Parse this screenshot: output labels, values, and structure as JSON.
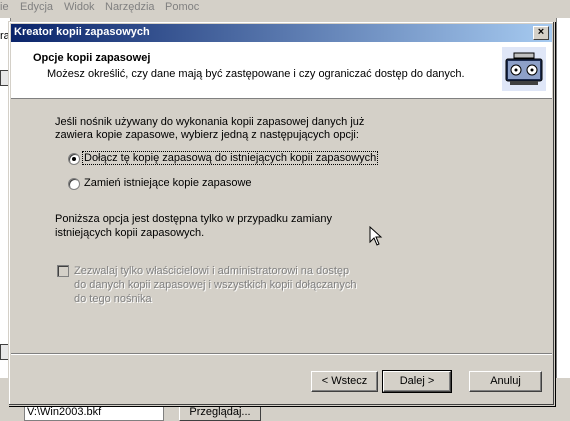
{
  "background_app": {
    "menu": [
      "ie",
      "Edycja",
      "Widok",
      "Narzędzia",
      "Pomoc"
    ],
    "cut_text": "ra",
    "backup_path": "V:\\Win2003.bkf",
    "browse_label": "Przeglądaj..."
  },
  "dialog": {
    "title": "Kreator kopii zapasowych",
    "close_glyph": "×",
    "header": {
      "title": "Opcje kopii zapasowej",
      "subtitle": "Możesz określić, czy dane mają być zastępowane i czy ograniczać dostęp do danych."
    },
    "intro_line1": "Jeśli nośnik używany do wykonania kopii zapasowej danych już",
    "intro_line2": "zawiera kopie zapasowe, wybierz jedną z następujących opcji:",
    "options": [
      {
        "label": "Dołącz tę kopię zapasową do istniejących kopii zapasowych",
        "selected": true
      },
      {
        "label": "Zamień istniejące kopie zapasowe",
        "selected": false
      }
    ],
    "note_line1": "Poniższa opcja jest dostępna tylko w przypadku zamiany",
    "note_line2": "istniejących kopii zapasowych.",
    "restrict_line1": "Zezwalaj tylko właścicielowi i administratorowi na dostęp",
    "restrict_line2": "do danych kopii zapasowej i wszystkich kopii dołączanych",
    "restrict_line3": "do tego nośnika",
    "buttons": {
      "back": "< Wstecz",
      "next": "Dalej >",
      "cancel": "Anuluj"
    }
  }
}
